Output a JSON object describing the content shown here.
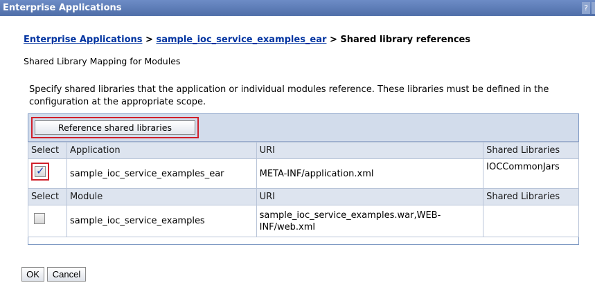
{
  "window": {
    "title": "Enterprise Applications",
    "help_label": "?"
  },
  "breadcrumb": {
    "link1": "Enterprise Applications",
    "sep1": " > ",
    "link2": "sample_ioc_service_examples_ear",
    "sep2": " > ",
    "current": "Shared library references"
  },
  "page": {
    "subtitle": "Shared Library Mapping for Modules",
    "description": "Specify shared libraries that the application or individual modules reference. These libraries must be defined in the configuration at the appropriate scope."
  },
  "toolbar": {
    "reference_button": "Reference shared libraries"
  },
  "table": {
    "app_header": {
      "select": "Select",
      "name": "Application",
      "uri": "URI",
      "libs": "Shared Libraries"
    },
    "app_row": {
      "checked": true,
      "name": "sample_ioc_service_examples_ear",
      "uri": "META-INF/application.xml",
      "libs": "IOCCommonJars"
    },
    "module_header": {
      "select": "Select",
      "name": "Module",
      "uri": "URI",
      "libs": "Shared Libraries"
    },
    "module_row": {
      "checked": false,
      "name": "sample_ioc_service_examples",
      "uri": "sample_ioc_service_examples.war,WEB-INF/web.xml",
      "libs": ""
    }
  },
  "buttons": {
    "ok": "OK",
    "cancel": "Cancel"
  },
  "colors": {
    "titlebar": "#5a7ab5",
    "link": "#0033a0",
    "highlight": "#d0202a",
    "toolbar_bg": "#d2dceb"
  }
}
